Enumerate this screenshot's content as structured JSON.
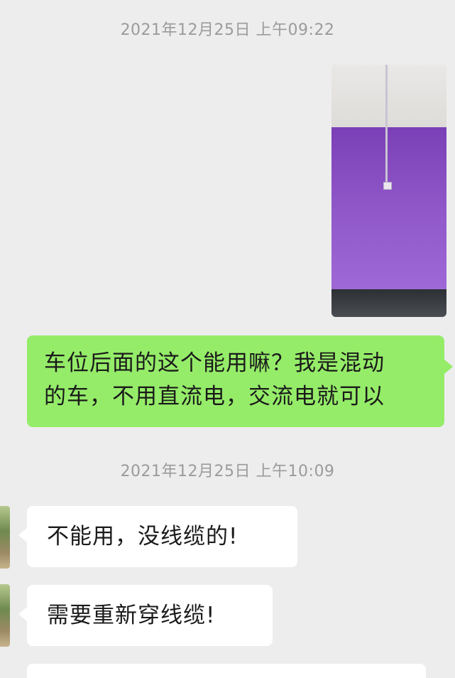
{
  "chat": {
    "timestamp_1": "2021年12月25日 上午09:22",
    "timestamp_2": "2021年12月25日 上午10:09",
    "messages": [
      {
        "side": "outgoing",
        "type": "image",
        "image_subject": "purple wall with white conduit and junction box above parking spot"
      },
      {
        "side": "outgoing",
        "type": "text",
        "lines": [
          "车位后面的这个能用嘛？我是混动",
          "的车，不用直流电，交流电就可以"
        ]
      },
      {
        "side": "incoming",
        "type": "text",
        "text": "不能用，没线缆的!"
      },
      {
        "side": "incoming",
        "type": "text",
        "text": "需要重新穿线缆!"
      }
    ]
  },
  "colors": {
    "background": "#ededed",
    "outgoing_bubble": "#95ec69",
    "incoming_bubble": "#ffffff",
    "timestamp_text": "#9b9b9b"
  }
}
